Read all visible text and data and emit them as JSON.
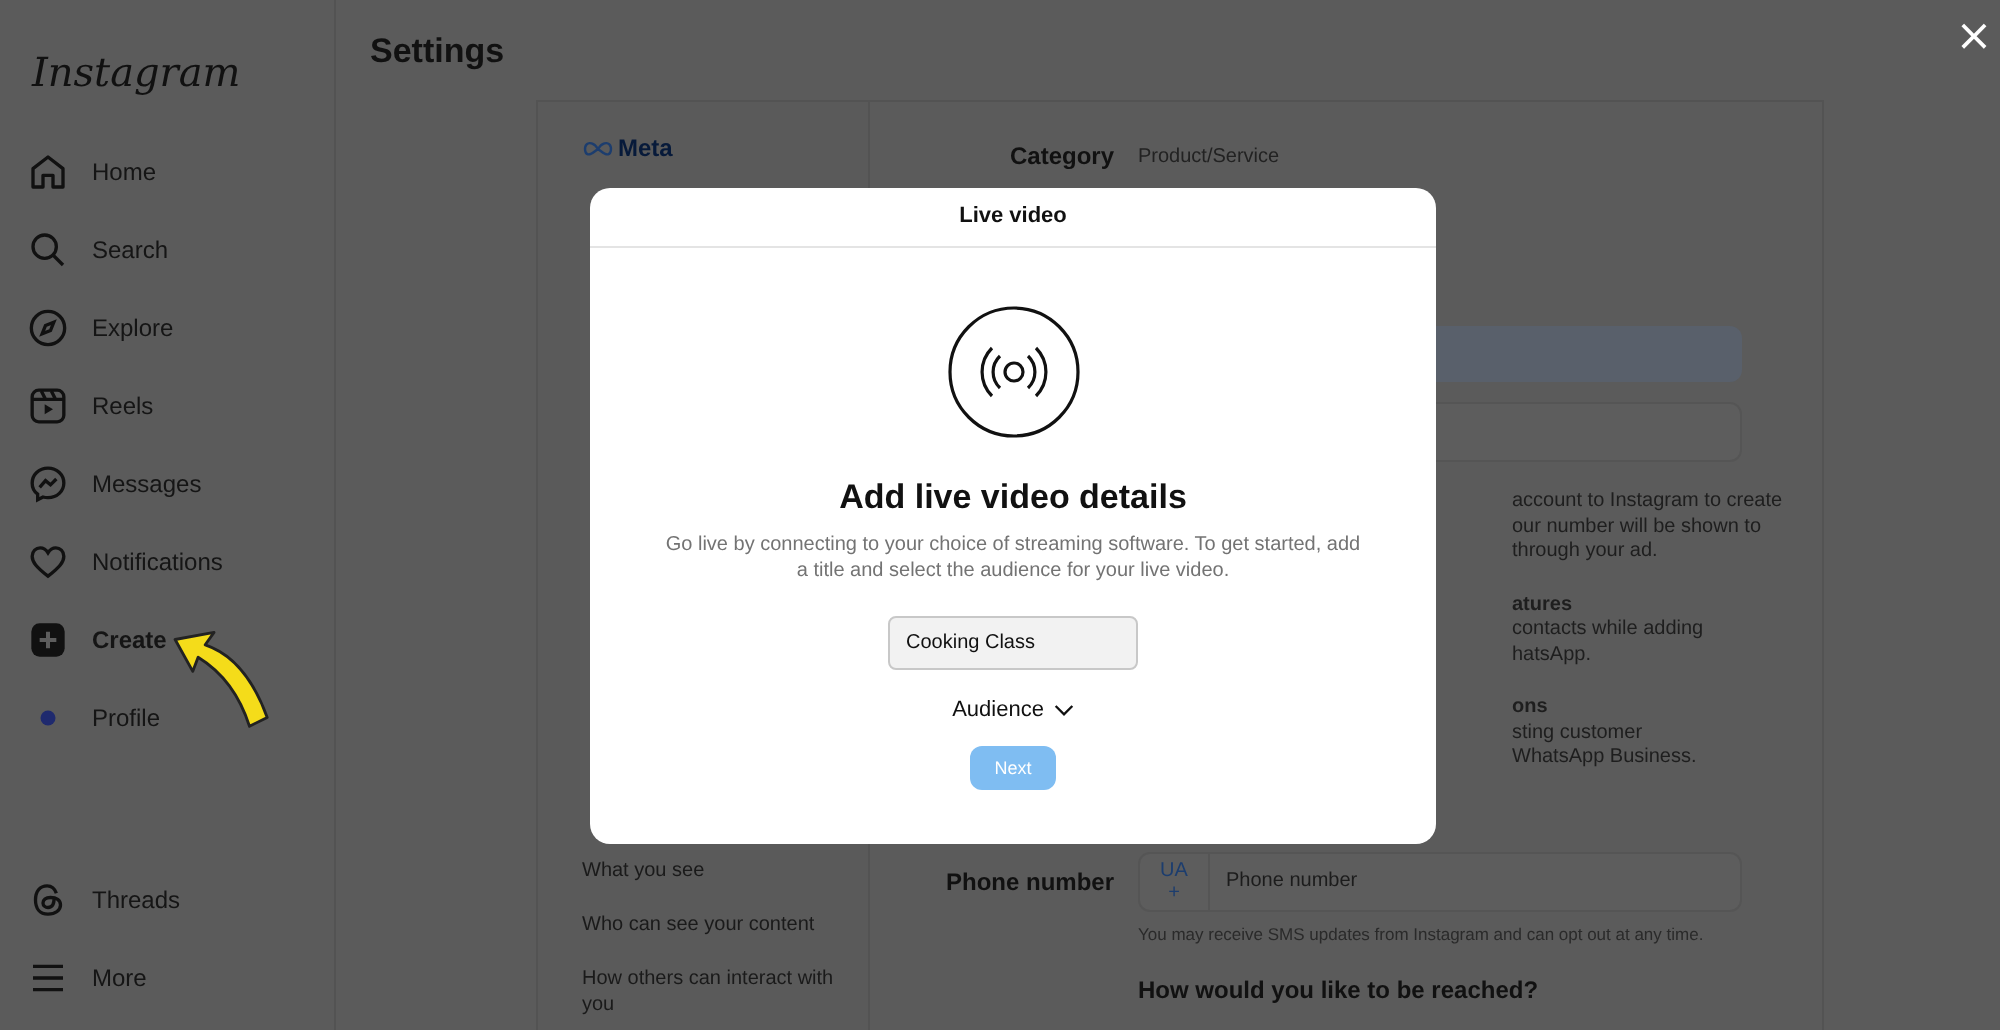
{
  "sidebar": {
    "logo": "Instagram",
    "items": [
      {
        "label": "Home",
        "selected": false
      },
      {
        "label": "Search",
        "selected": false
      },
      {
        "label": "Explore",
        "selected": false
      },
      {
        "label": "Reels",
        "selected": false
      },
      {
        "label": "Messages",
        "selected": false
      },
      {
        "label": "Notifications",
        "selected": false
      },
      {
        "label": "Create",
        "selected": true
      },
      {
        "label": "Profile",
        "selected": false
      }
    ],
    "bottom_items": [
      {
        "label": "Threads"
      },
      {
        "label": "More"
      }
    ]
  },
  "settings": {
    "title": "Settings",
    "brand": "Meta",
    "menu_items": [
      "What you see",
      "Who can see your content",
      "How others can interact with you"
    ]
  },
  "profile_form": {
    "category_label": "Category",
    "category_value": "Product/Service",
    "visible_lines": [
      [
        "account to Instagram to create",
        "our number will be shown to",
        "through your ad."
      ],
      [
        "atures",
        "contacts while adding",
        "hatsApp."
      ],
      [
        "ons",
        "sting customer",
        "WhatsApp Business."
      ]
    ],
    "phone_label": "Phone number",
    "country_code": "UA",
    "country_sign": "+",
    "phone_placeholder": "Phone number",
    "phone_hint": "You may receive SMS updates from Instagram and can opt out at any time.",
    "reach_heading": "How would you like to be reached?"
  },
  "dialog": {
    "title": "Live video",
    "heading": "Add live video details",
    "description": "Go live by connecting to your choice of streaming software. To get started, add a title and select the audience for your live video.",
    "title_value": "Cooking Class",
    "audience": "Audience",
    "next_button": {
      "label": "Next",
      "disabled": true
    }
  },
  "close": "×"
}
